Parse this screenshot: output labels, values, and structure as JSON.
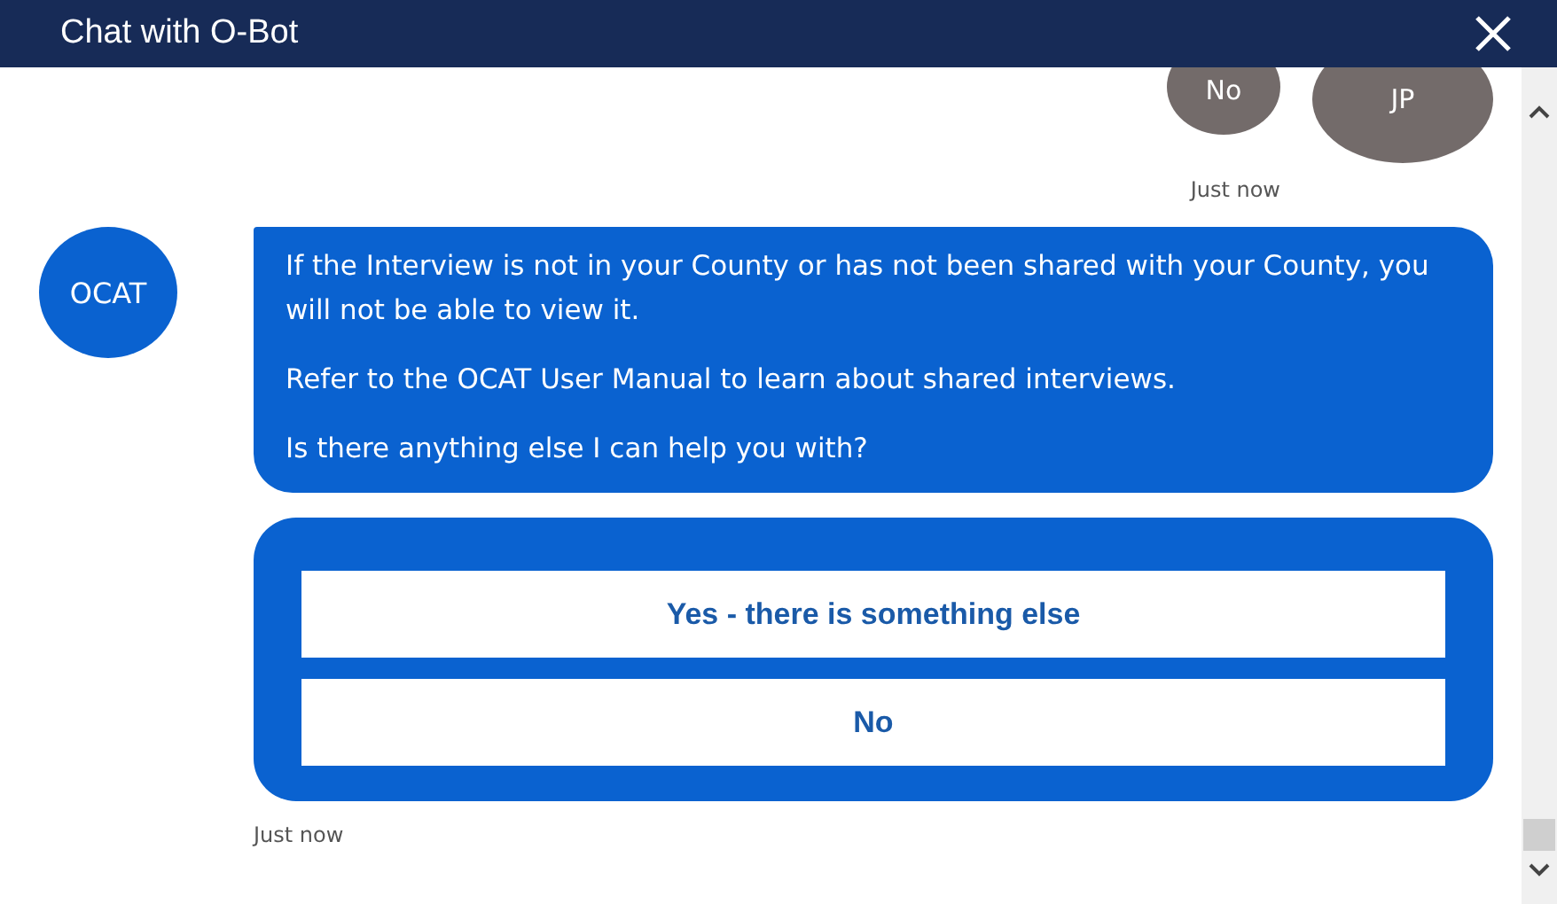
{
  "window": {
    "title": "Chat with O-Bot"
  },
  "messages": [
    {
      "kind": "user",
      "text": "No",
      "avatar": "JP",
      "time": "Just now"
    },
    {
      "kind": "bot",
      "avatar": "OCAT",
      "paragraphs": [
        "If the Interview is not in your County or has not been shared with your County, you will not be able to view it.",
        "Refer to the OCAT User Manual to learn about shared interviews.",
        "Is there anything else I can help you with?"
      ]
    },
    {
      "kind": "choices",
      "options": [
        "Yes - there is something else",
        "No"
      ],
      "time": "Just now"
    }
  ]
}
